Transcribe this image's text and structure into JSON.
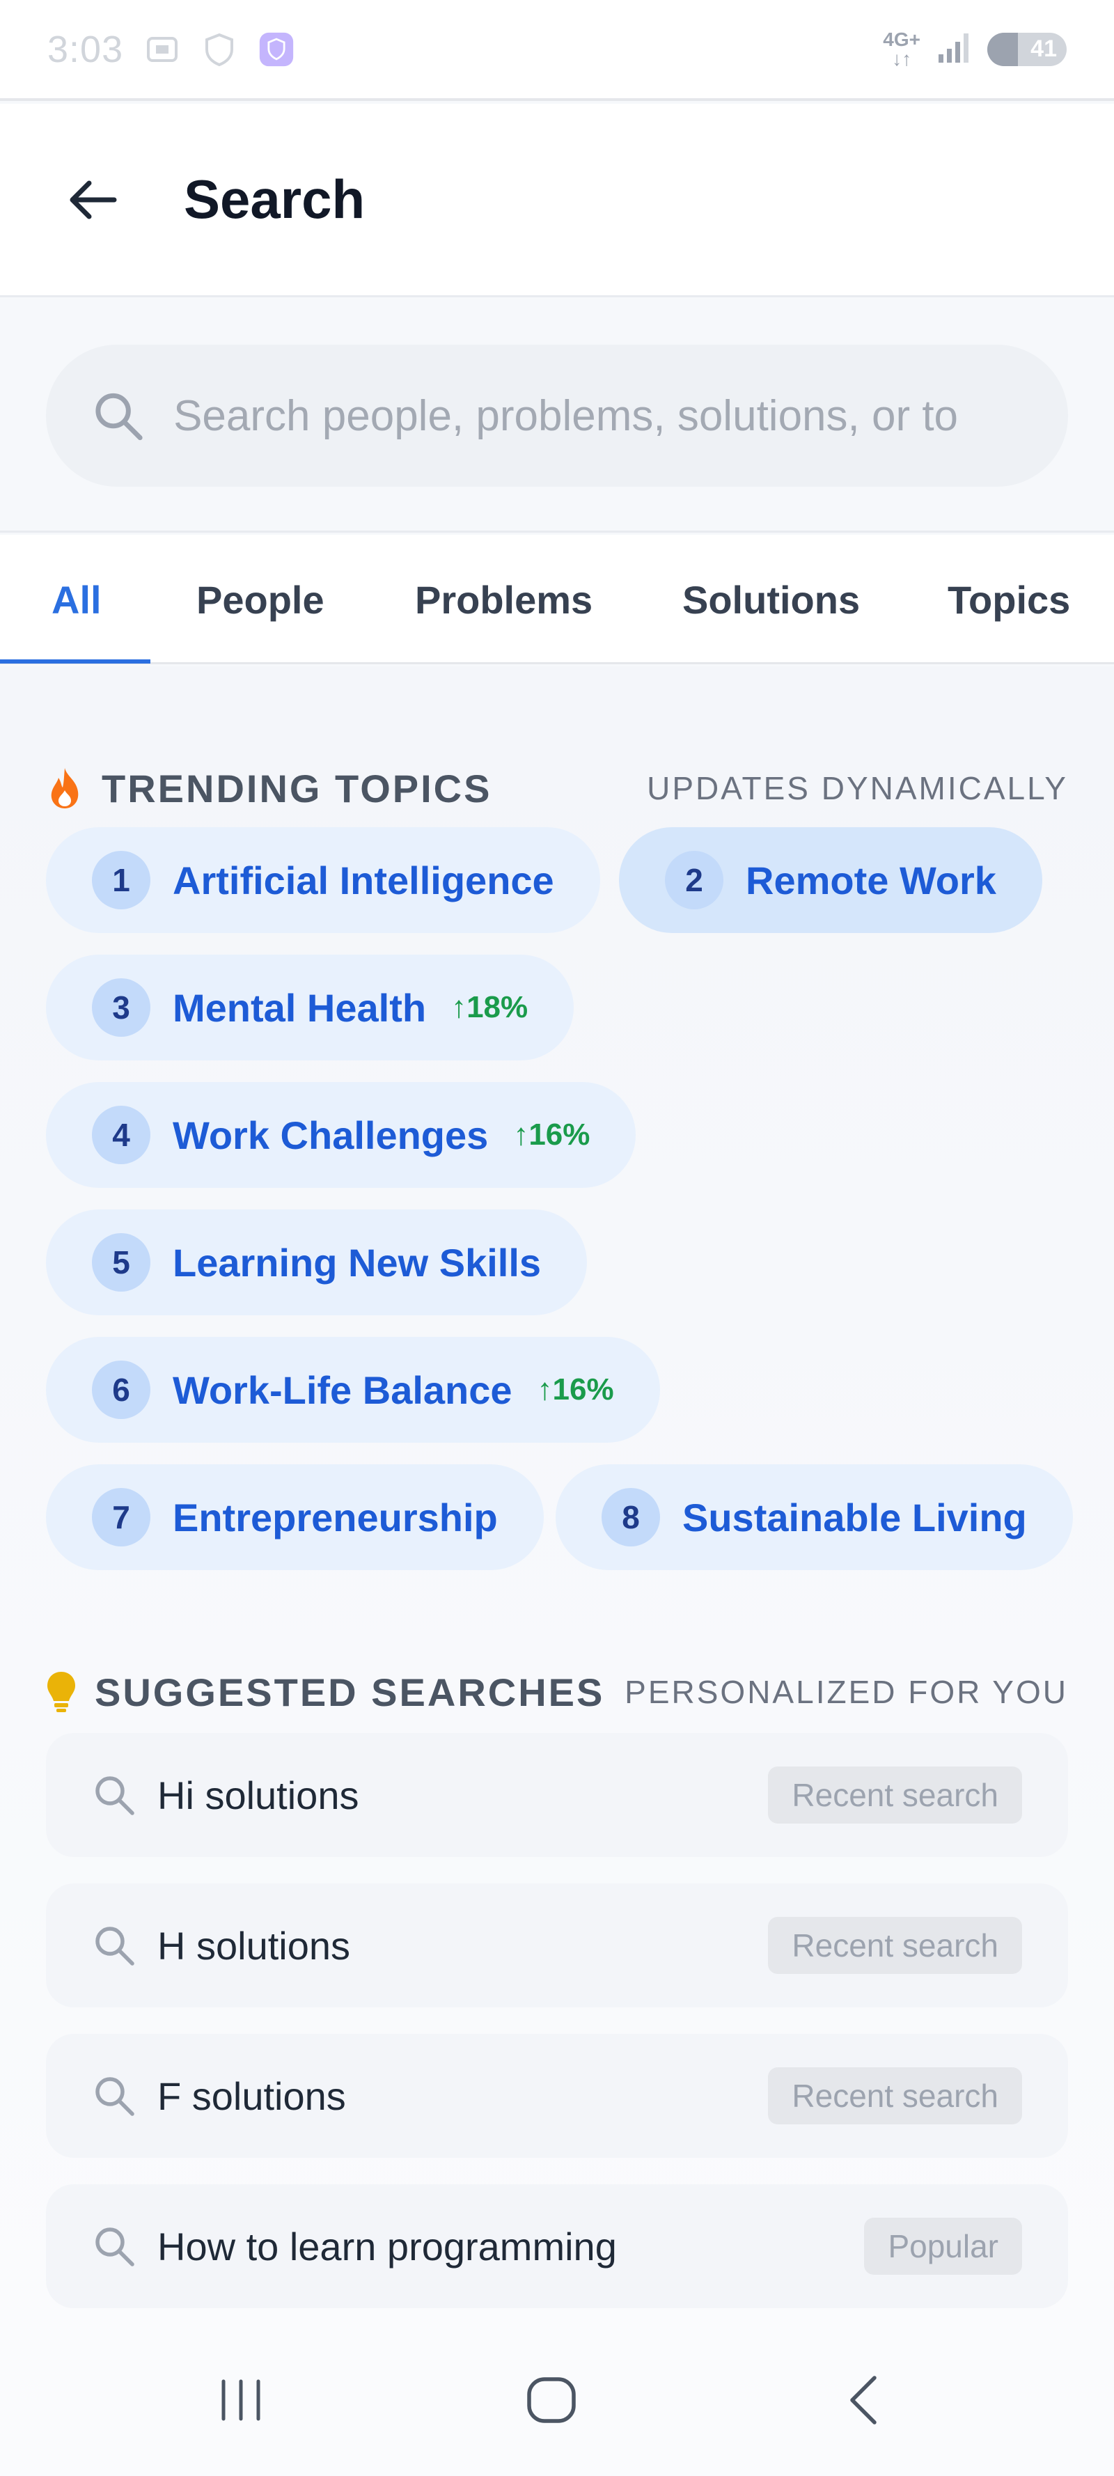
{
  "status": {
    "time": "3:03",
    "network_top": "4G+",
    "network_bottom": "↓↑",
    "battery": "41"
  },
  "header": {
    "title": "Search"
  },
  "search": {
    "placeholder": "Search people, problems, solutions, or to"
  },
  "tabs": [
    {
      "label": "All",
      "active": true
    },
    {
      "label": "People",
      "active": false
    },
    {
      "label": "Problems",
      "active": false
    },
    {
      "label": "Solutions",
      "active": false
    },
    {
      "label": "Topics",
      "active": false
    }
  ],
  "trending": {
    "title": "TRENDING TOPICS",
    "note": "UPDATES DYNAMICALLY",
    "items": [
      {
        "rank": "1",
        "label": "Artificial Intelligence",
        "trend": ""
      },
      {
        "rank": "2",
        "label": "Remote Work",
        "trend": ""
      },
      {
        "rank": "3",
        "label": "Mental Health",
        "trend": "↑18%"
      },
      {
        "rank": "4",
        "label": "Work Challenges",
        "trend": "↑16%"
      },
      {
        "rank": "5",
        "label": "Learning New Skills",
        "trend": ""
      },
      {
        "rank": "6",
        "label": "Work-Life Balance",
        "trend": "↑16%"
      },
      {
        "rank": "7",
        "label": "Entrepreneurship",
        "trend": ""
      },
      {
        "rank": "8",
        "label": "Sustainable Living",
        "trend": ""
      }
    ]
  },
  "suggested": {
    "title": "SUGGESTED SEARCHES",
    "note": "PERSONALIZED FOR YOU",
    "items": [
      {
        "text": "Hi solutions",
        "badge": "Recent search"
      },
      {
        "text": "H solutions",
        "badge": "Recent search"
      },
      {
        "text": "F solutions",
        "badge": "Recent search"
      },
      {
        "text": "How to learn programming",
        "badge": "Popular"
      }
    ]
  },
  "colors": {
    "accent": "#2b6fe0",
    "chip_bg": "#e8f1fd",
    "trend_green": "#1a9b4b",
    "fire": "#f97316",
    "bulb": "#eab308"
  },
  "icons": [
    "back-arrow-icon",
    "search-icon",
    "fire-icon",
    "lightbulb-icon"
  ]
}
